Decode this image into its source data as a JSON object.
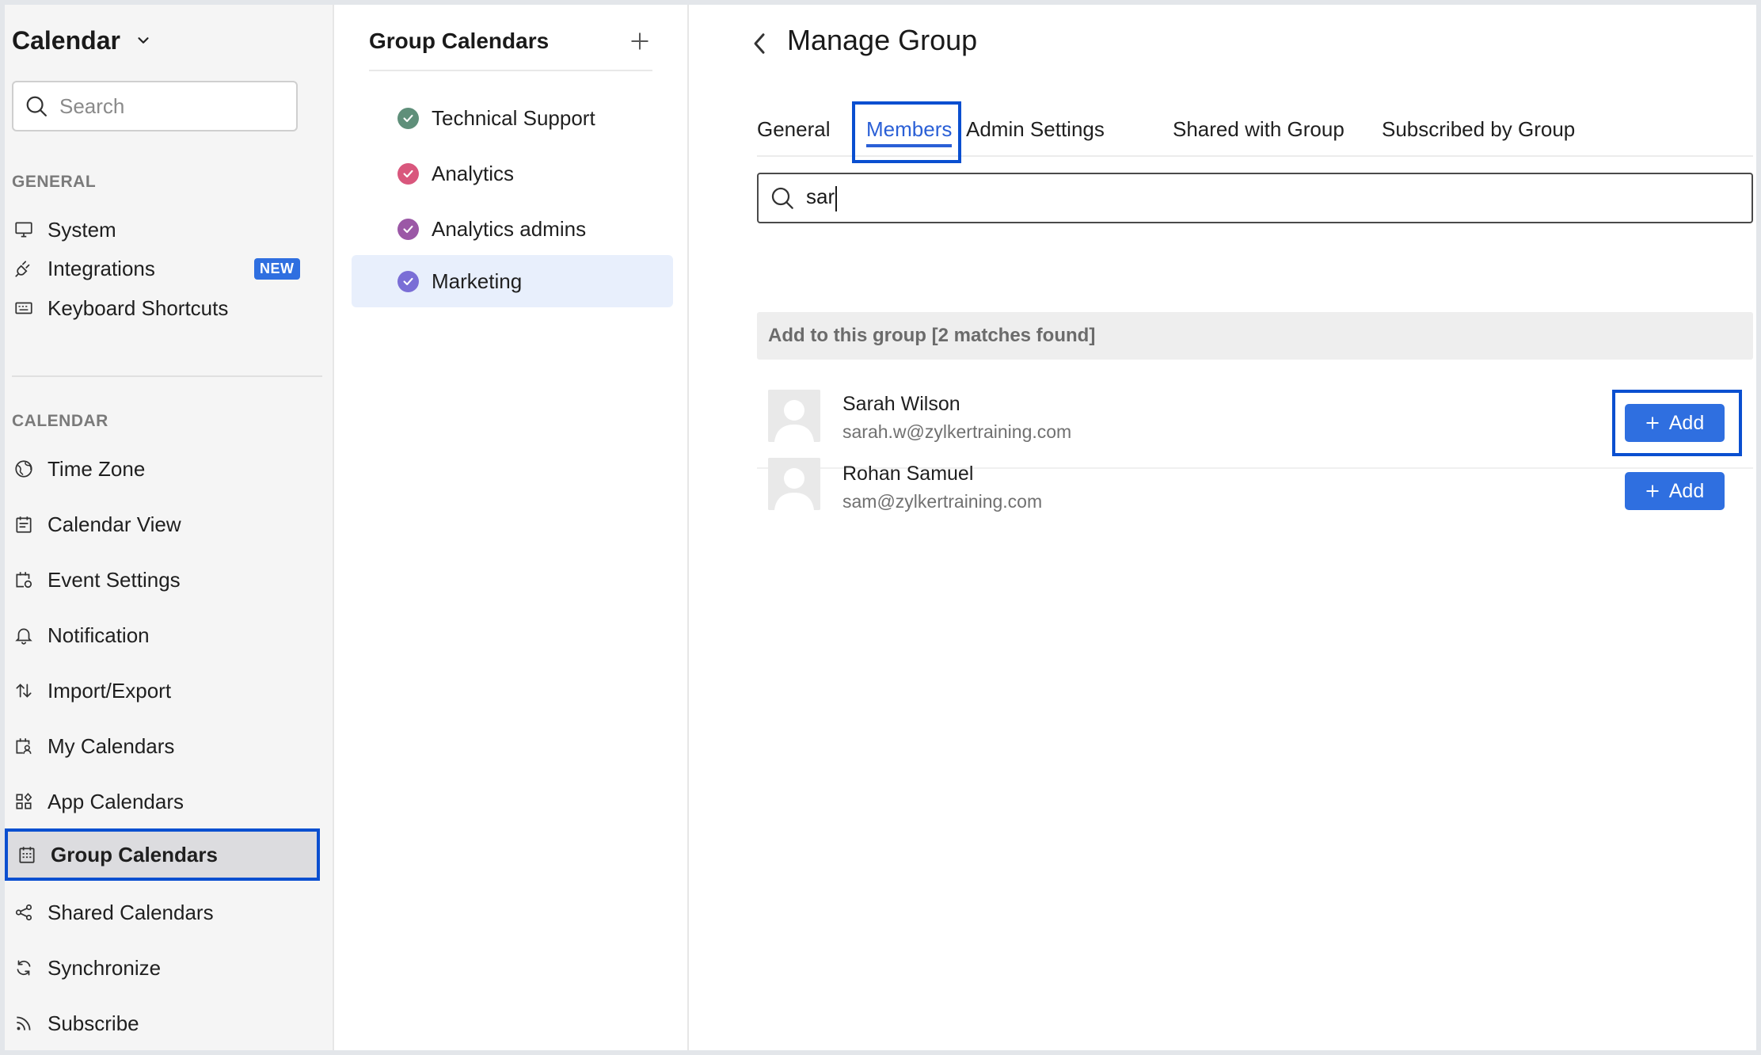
{
  "sidebar": {
    "app_title": "Calendar",
    "search_placeholder": "Search",
    "general_label": "GENERAL",
    "general_items": [
      {
        "label": "System",
        "icon": "monitor-icon"
      },
      {
        "label": "Integrations",
        "icon": "plug-icon",
        "badge": "NEW"
      },
      {
        "label": "Keyboard Shortcuts",
        "icon": "keyboard-icon"
      }
    ],
    "calendar_label": "CALENDAR",
    "calendar_items": [
      {
        "label": "Time Zone",
        "icon": "globe-icon"
      },
      {
        "label": "Calendar View",
        "icon": "calendar-view-icon"
      },
      {
        "label": "Event Settings",
        "icon": "event-settings-icon"
      },
      {
        "label": "Notification",
        "icon": "bell-icon"
      },
      {
        "label": "Import/Export",
        "icon": "import-export-icon"
      },
      {
        "label": "My Calendars",
        "icon": "my-calendars-icon"
      },
      {
        "label": "App Calendars",
        "icon": "apps-grid-icon"
      },
      {
        "label": "Group Calendars",
        "icon": "group-calendar-icon",
        "active": true
      },
      {
        "label": "Shared Calendars",
        "icon": "share-icon"
      },
      {
        "label": "Synchronize",
        "icon": "sync-icon"
      },
      {
        "label": "Subscribe",
        "icon": "rss-icon"
      }
    ]
  },
  "groups_panel": {
    "title": "Group Calendars",
    "items": [
      {
        "label": "Technical Support",
        "color": "#5f8f7a"
      },
      {
        "label": "Analytics",
        "color": "#d9577d"
      },
      {
        "label": "Analytics admins",
        "color": "#9b58a6"
      },
      {
        "label": "Marketing",
        "color": "#7a6ed6",
        "selected": true
      }
    ]
  },
  "main": {
    "title": "Manage Group",
    "tabs": [
      "General",
      "Members",
      "Admin Settings",
      "Shared with Group",
      "Subscribed by Group"
    ],
    "active_tab": "Members",
    "search_value": "sar",
    "results_header": "Add to this group [2 matches found]",
    "members": [
      {
        "name": "Sarah Wilson",
        "email": "sarah.w@zylkertraining.com",
        "add_label": "Add"
      },
      {
        "name": "Rohan Samuel",
        "email": "sam@zylkertraining.com",
        "add_label": "Add"
      }
    ]
  },
  "colors": {
    "accent": "#2f6fe0",
    "highlight_border": "#0a4fd0",
    "active_tab": "#2a5fd6"
  }
}
